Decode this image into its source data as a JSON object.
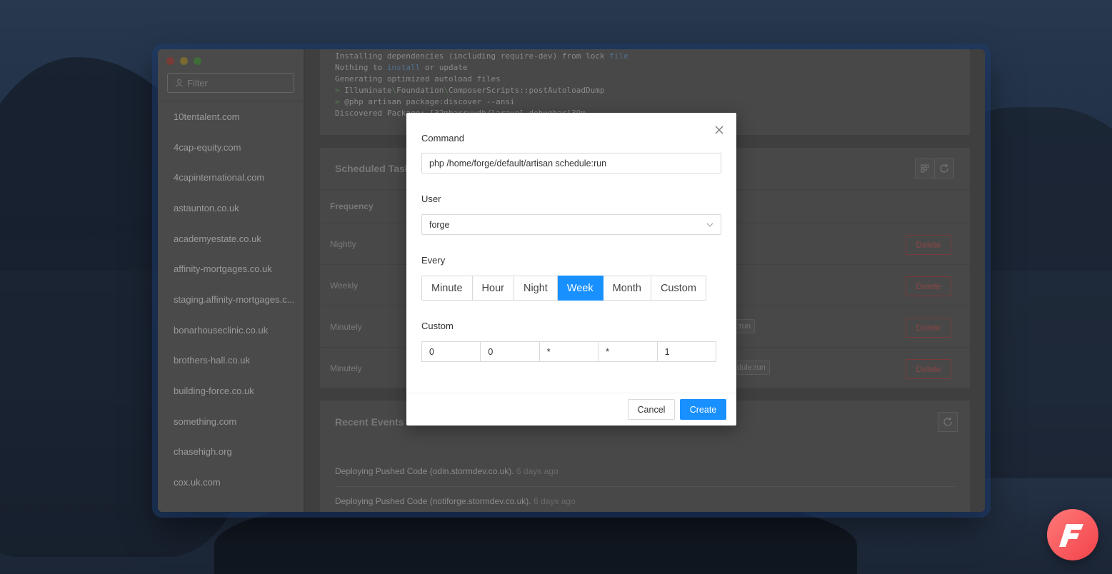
{
  "sidebar": {
    "filter_placeholder": "Filter",
    "sites": [
      "10tentalent.com",
      "4cap-equity.com",
      "4capinternational.com",
      "astaunton.co.uk",
      "academyestate.co.uk",
      "affinity-mortgages.co.uk",
      "staging.affinity-mortgages.c...",
      "bonarhouseclinic.co.uk",
      "brothers-hall.co.uk",
      "building-force.co.uk",
      "something.com",
      "chasehigh.org",
      "cox.uk.com"
    ]
  },
  "console": {
    "line1_a": "Installing dependencies (including require-dev) from lock ",
    "line1_b": "file",
    "line2_a": "Nothing to ",
    "line2_b": "install",
    "line2_c": " or update",
    "line3": "Generating optimized autoload files",
    "line4_prompt": "> ",
    "line4_a": "Illuminate",
    "line4_sep1": "\\",
    "line4_b": "Foundation",
    "line4_sep2": "\\",
    "line4_c": "ComposerScripts::postAutoloadDump",
    "line5_prompt": "> ",
    "line5": "@php artisan package:discover --ansi",
    "line6": "Discovered Package: [32mbarryvdh/laravel-debugbar[39m"
  },
  "scheduled": {
    "title": "Scheduled Tasks",
    "column_frequency": "Frequency",
    "rows": [
      {
        "frequency": "Nightly",
        "command": "",
        "delete": "Delete"
      },
      {
        "frequency": "Weekly",
        "command": "",
        "delete": "Delete"
      },
      {
        "frequency": "Minutely",
        "command": ":run",
        "delete": "Delete"
      },
      {
        "frequency": "Minutely",
        "command": "dule:run",
        "delete": "Delete"
      }
    ]
  },
  "recent": {
    "title": "Recent Events",
    "events": [
      {
        "text": "Deploying Pushed Code (odin.stormdev.co.uk).",
        "ago": "6 days ago"
      },
      {
        "text": "Deploying Pushed Code (notiforge.stormdev.co.uk).",
        "ago": "6 days ago"
      }
    ]
  },
  "modal": {
    "command_label": "Command",
    "command_value": "php /home/forge/default/artisan schedule:run",
    "user_label": "User",
    "user_value": "forge",
    "every_label": "Every",
    "every_options": [
      "Minute",
      "Hour",
      "Night",
      "Week",
      "Month",
      "Custom"
    ],
    "every_selected": "Week",
    "custom_label": "Custom",
    "custom_values": [
      "0",
      "0",
      "*",
      "*",
      "1"
    ],
    "cancel_label": "Cancel",
    "create_label": "Create"
  },
  "brand": {
    "letter": "F"
  },
  "colors": {
    "accent": "#1890ff",
    "danger": "#f5222d",
    "brand": "#f2424a"
  }
}
